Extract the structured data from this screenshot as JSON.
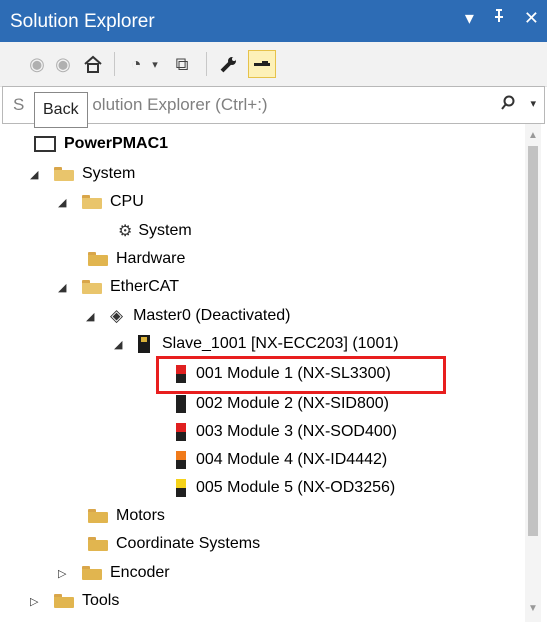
{
  "panel": {
    "title": "Solution Explorer",
    "ctrl_dropdown": "▾",
    "ctrl_pin": "ᵖ",
    "ctrl_close": "✕"
  },
  "toolbar": {
    "back": "◉",
    "forward": "◉",
    "home": "⌂",
    "history": "◔",
    "history_drop": "▾",
    "sync": "⧉",
    "properties": "🔧",
    "preview": "▬"
  },
  "search": {
    "placeholder": "Search Solution Explorer (Ctrl+:)",
    "visible_text": "olution Explorer (Ctrl+:)",
    "prefix": "S",
    "icon": "⚲",
    "drop": "▾"
  },
  "tooltip": {
    "text": "Back"
  },
  "tree": {
    "root": "PowerPMAC1",
    "items": [
      {
        "label": "System",
        "arrow": "◢",
        "icon": "folder-open"
      },
      {
        "label": "CPU",
        "arrow": "◢",
        "icon": "folder-open"
      },
      {
        "label": "System",
        "arrow": "",
        "icon": "gear-file"
      },
      {
        "label": "Hardware",
        "arrow": "",
        "icon": "folder"
      },
      {
        "label": "EtherCAT",
        "arrow": "◢",
        "icon": "folder-open"
      },
      {
        "label": "Master0 (Deactivated)",
        "arrow": "◢",
        "icon": "master"
      },
      {
        "label": "Slave_1001 [NX-ECC203] (1001)",
        "arrow": "◢",
        "icon": "slave"
      },
      {
        "label": "001 Module 1 (NX-SL3300)",
        "arrow": "",
        "icon": "module",
        "color": "#e02020"
      },
      {
        "label": "002 Module 2 (NX-SID800)",
        "arrow": "",
        "icon": "module",
        "color": "#202020"
      },
      {
        "label": "003 Module 3 (NX-SOD400)",
        "arrow": "",
        "icon": "module",
        "color": "#e02020"
      },
      {
        "label": "004 Module 4 (NX-ID4442)",
        "arrow": "",
        "icon": "module",
        "color": "#f07a1a"
      },
      {
        "label": "005 Module 5 (NX-OD3256)",
        "arrow": "",
        "icon": "module",
        "color": "#f5d21a"
      },
      {
        "label": "Motors",
        "arrow": "",
        "icon": "folder"
      },
      {
        "label": "Coordinate Systems",
        "arrow": "",
        "icon": "folder"
      },
      {
        "label": "Encoder",
        "arrow": "▷",
        "icon": "folder"
      },
      {
        "label": "Tools",
        "arrow": "▷",
        "icon": "folder"
      }
    ]
  },
  "colors": {
    "titlebar": "#2d6cb5",
    "highlight": "#e81e1e"
  }
}
